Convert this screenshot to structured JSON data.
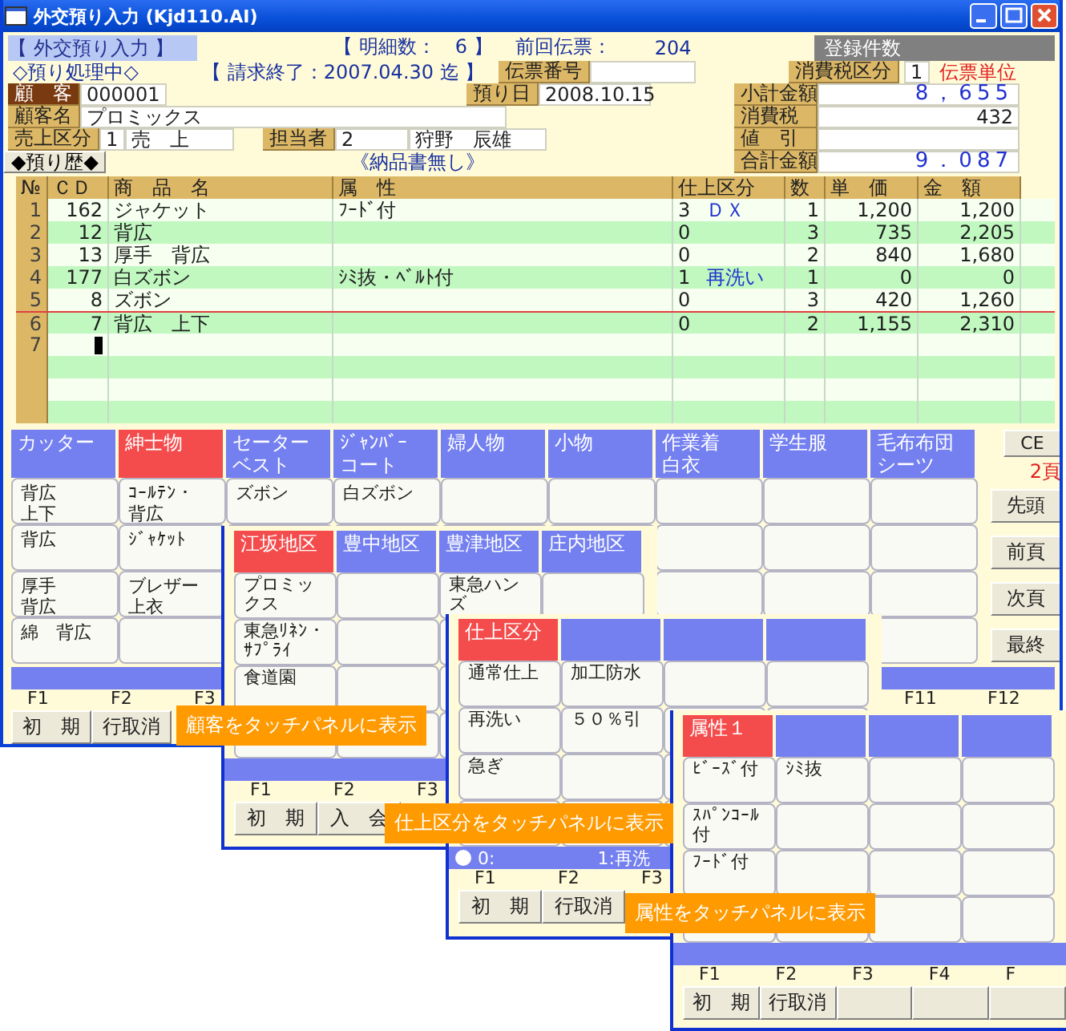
{
  "window": {
    "title": "外交預り入力 (Kjd110.AI)"
  },
  "header": {
    "screen_name": "【 外交預り入力 】",
    "detail_count": "【 明細数：　6 】",
    "prev_slip_label": "前回伝票：",
    "prev_slip": "204",
    "registered_count": "登録件数",
    "status": "◇預り処理中◇",
    "billing_end": "【 請求終了：2007.04.30 迄 】"
  },
  "slip": {
    "number_label": "伝票番号",
    "date_label": "預り日",
    "date": "2008.10.15"
  },
  "tax": {
    "label": "消費税区分",
    "code": "1",
    "unit": "伝票単位"
  },
  "customer": {
    "code_label": "顧　客",
    "code": "000001",
    "name_label": "顧客名",
    "name": "プロミックス",
    "sales_label": "売上区分",
    "sales_code": "1",
    "sales_name": "売　上",
    "staff_label": "担当者",
    "staff_code": "2",
    "staff_name": "狩野　辰雄"
  },
  "history_button": "◆預り歴◆",
  "delivery_note": "《納品書無し》",
  "totals": [
    {
      "label": "小計金額",
      "value": "8，655",
      "kind": "big"
    },
    {
      "label": "消費税",
      "value": "432",
      "kind": "plain"
    },
    {
      "label": "値　引",
      "kind": "plain"
    },
    {
      "label": "合計金額",
      "value": "9．087",
      "kind": "big"
    }
  ],
  "table": {
    "columns": [
      "№",
      "ＣＤ",
      "商　品　名",
      "属　性",
      "仕上区分",
      "数",
      "単　価",
      "金　額"
    ],
    "rows": [
      {
        "no": "1",
        "cd": "162",
        "name": "ジャケット",
        "attr": "ﾌｰﾄﾞ付",
        "finish_code": "3",
        "finish_name": "ＤＸ",
        "qty": "1",
        "price": "1,200",
        "amount": "1,200",
        "selected": false,
        "cursor": false
      },
      {
        "no": "2",
        "cd": "12",
        "name": "背広",
        "finish_code": "0",
        "qty": "3",
        "price": "735",
        "amount": "2,205",
        "selected": false,
        "cursor": false
      },
      {
        "no": "3",
        "cd": "13",
        "name": "厚手　背広",
        "finish_code": "0",
        "qty": "2",
        "price": "840",
        "amount": "1,680",
        "selected": false,
        "cursor": false
      },
      {
        "no": "4",
        "cd": "177",
        "name": "白ズボン",
        "attr": "ｼﾐ抜・ﾍﾞﾙﾄ付",
        "finish_code": "1",
        "finish_name": "再洗い",
        "qty": "1",
        "price": "0",
        "amount": "0",
        "selected": false,
        "cursor": false
      },
      {
        "no": "5",
        "cd": "8",
        "name": "ズボン",
        "finish_code": "0",
        "qty": "3",
        "price": "420",
        "amount": "1,260",
        "selected": false,
        "cursor": false
      },
      {
        "no": "6",
        "cd": "7",
        "name": "背広　上下",
        "finish_code": "0",
        "qty": "2",
        "price": "1,155",
        "amount": "2,310",
        "selected": true,
        "cursor": false
      },
      {
        "no": "7",
        "selected": false,
        "cursor": true
      }
    ]
  },
  "side_buttons": [
    {
      "label": "CE",
      "kind": "button"
    },
    {
      "label": "2頁",
      "kind": "page"
    },
    {
      "label": "先頭",
      "kind": "button"
    },
    {
      "label": "前頁",
      "kind": "button"
    },
    {
      "label": "次頁",
      "kind": "button"
    },
    {
      "label": "最終",
      "kind": "button"
    }
  ],
  "panels": [
    {
      "tabs": [
        {
          "label": "カッター",
          "selected": false
        },
        {
          "label": "紳士物",
          "selected": true
        },
        {
          "lines": [
            "セーター",
            "ベスト"
          ],
          "selected": false
        },
        {
          "lines": [
            "ｼﾞｬﾝﾊﾞｰ",
            "コート"
          ],
          "selected": false
        },
        {
          "label": "婦人物",
          "selected": false
        },
        {
          "label": "小物",
          "selected": false
        },
        {
          "lines": [
            "作業着",
            "白衣"
          ],
          "selected": false
        },
        {
          "label": "学生服",
          "selected": false
        },
        {
          "lines": [
            "毛布布団",
            "シーツ"
          ],
          "selected": false
        }
      ],
      "cells": [
        [
          {
            "lines": [
              "背広",
              "上下"
            ]
          },
          {
            "lines": [
              "ｺｰﾙﾃﾝ・",
              "背広"
            ]
          },
          {
            "text": "ズボン"
          },
          {
            "text": "白ズボン"
          },
          {},
          {},
          {},
          {},
          {}
        ],
        [
          {
            "text": "背広"
          },
          {
            "text": "ｼﾞｬｹｯﾄ"
          },
          {},
          {},
          {},
          {},
          {},
          {},
          {}
        ],
        [
          {
            "lines": [
              "厚手",
              "背広"
            ]
          },
          {
            "lines": [
              "ブレザー",
              "上衣"
            ]
          },
          {},
          {},
          {},
          {},
          {},
          {},
          {}
        ],
        [
          {
            "text": "綿　背広"
          },
          {},
          {},
          {},
          {},
          {},
          {},
          {},
          {}
        ]
      ],
      "fkeys": [
        {
          "label": "F1"
        },
        {
          "label": "F2"
        },
        {
          "label": "F3"
        }
      ],
      "fkeys_right": [
        {
          "label": "F11"
        },
        {
          "label": "F12"
        }
      ],
      "buttons": [
        {
          "label": "初　期"
        },
        {
          "label": "行取消"
        }
      ]
    },
    {
      "tabs": [
        {
          "label": "江坂地区",
          "selected": true
        },
        {
          "label": "豊中地区",
          "selected": false
        },
        {
          "label": "豊津地区",
          "selected": false
        },
        {
          "label": "庄内地区",
          "selected": false
        }
      ],
      "cells": [
        [
          {
            "lines": [
              "プロミッ",
              "クス"
            ]
          },
          {},
          {
            "lines": [
              "東急ハン",
              "ズ"
            ]
          },
          {}
        ],
        [
          {
            "lines": [
              "東急ﾘﾈﾝ・",
              "ｻﾌﾟﾗｲ"
            ]
          },
          {},
          {},
          {}
        ],
        [
          {
            "text": "食道園"
          },
          {},
          {},
          {}
        ],
        [
          {},
          {},
          {},
          {}
        ]
      ],
      "fkeys": [
        {
          "label": "F1"
        },
        {
          "label": "F2"
        },
        {
          "label": "F3"
        }
      ],
      "buttons": [
        {
          "label": "初　期"
        },
        {
          "label": "入　会"
        }
      ]
    },
    {
      "tabs": [
        {
          "label": "仕上区分",
          "selected": true
        },
        {
          "selected": false
        },
        {
          "selected": false
        },
        {
          "selected": false
        }
      ],
      "cells": [
        [
          {
            "text": "通常仕上"
          },
          {
            "text": "加工防水"
          },
          {},
          {}
        ],
        [
          {
            "text": "再洗い"
          },
          {
            "text": "５０％引"
          },
          {},
          {}
        ],
        [
          {
            "text": "急ぎ"
          },
          {},
          {},
          {}
        ],
        [
          {},
          {},
          {},
          {}
        ]
      ],
      "status": {
        "left": "0:",
        "right": "1:再洗"
      },
      "fkeys": [
        {
          "label": "F1"
        },
        {
          "label": "F2"
        },
        {
          "label": "F3"
        }
      ],
      "buttons": [
        {
          "label": "初　期"
        },
        {
          "label": "行取消"
        }
      ]
    },
    {
      "tabs": [
        {
          "label": "属性１",
          "selected": true
        },
        {
          "selected": false
        },
        {
          "selected": false
        },
        {
          "selected": false
        }
      ],
      "cells": [
        [
          {
            "text": "ﾋﾞｰｽﾞ付"
          },
          {
            "text": "ｼﾐ抜"
          },
          {},
          {}
        ],
        [
          {
            "lines": [
              "ｽﾊﾟﾝｺｰﾙ",
              "付"
            ]
          },
          {},
          {},
          {}
        ],
        [
          {
            "text": "ﾌｰﾄﾞ付"
          },
          {},
          {},
          {}
        ],
        [
          {},
          {},
          {},
          {}
        ]
      ],
      "fkeys": [
        {
          "label": "F1"
        },
        {
          "label": "F2"
        },
        {
          "label": "F3"
        },
        {
          "label": "F4"
        },
        {
          "label": "F"
        }
      ],
      "buttons": [
        {
          "label": "初　期"
        },
        {
          "label": "行取消"
        }
      ]
    }
  ],
  "callouts": [
    "顧客をタッチパネルに表示",
    "仕上区分をタッチパネルに表示",
    "属性をタッチパネルに表示"
  ]
}
